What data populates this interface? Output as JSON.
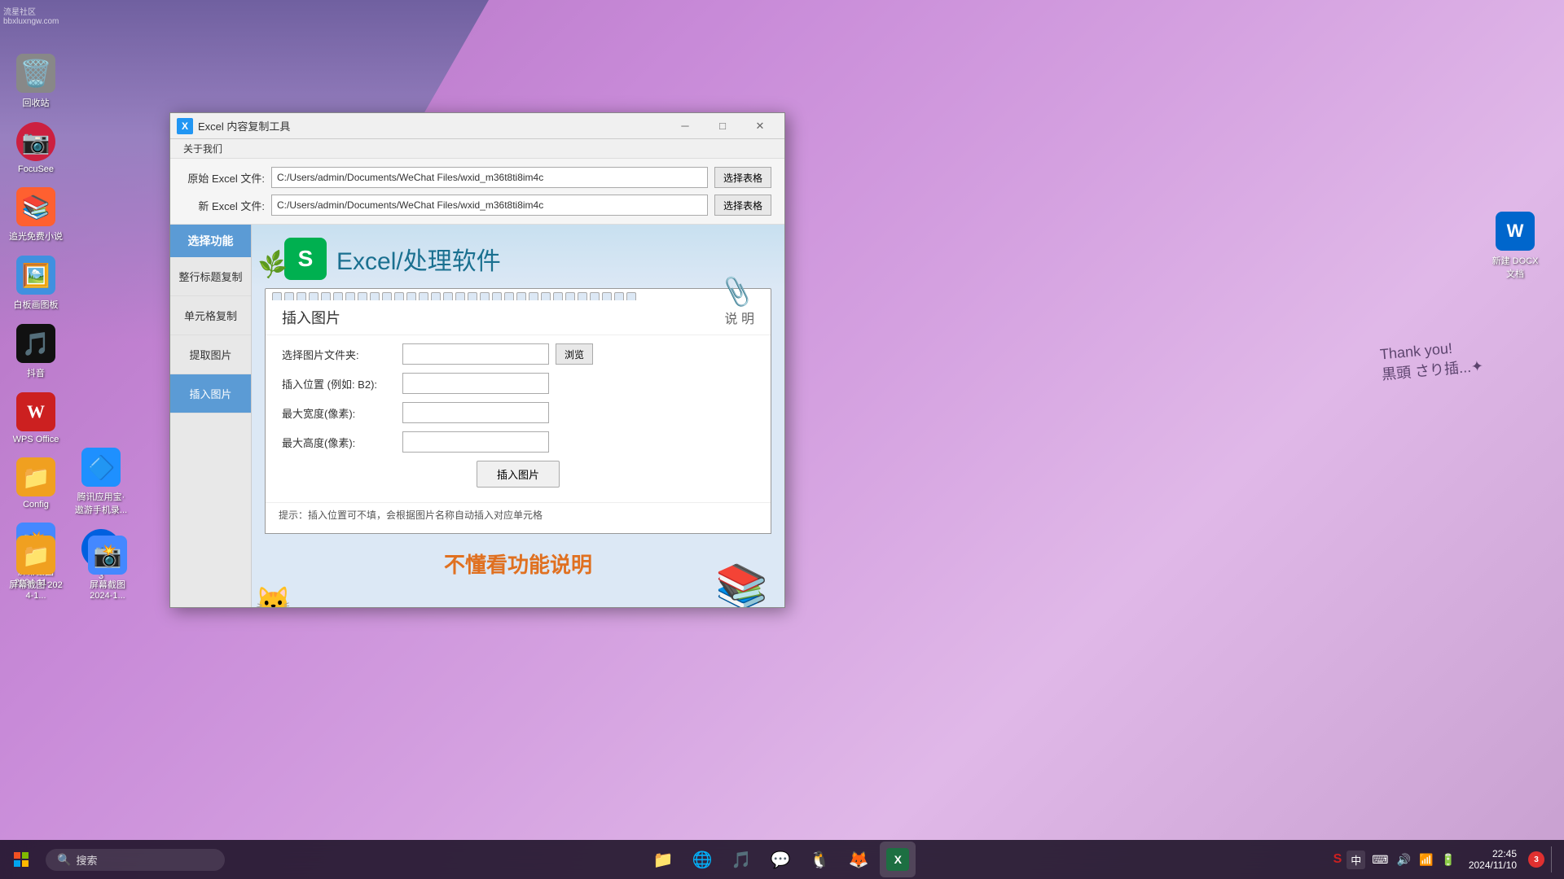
{
  "desktop": {
    "watermark": "流星社区\nbbxluxngw.com",
    "bg_color": "#c8a0d8"
  },
  "icons_left": [
    {
      "id": "recycle-bin",
      "label": "回收站",
      "emoji": "🗑️",
      "bg": "#e8e8e8"
    },
    {
      "id": "focussee",
      "label": "FocuSee",
      "emoji": "📷",
      "bg": "#e03050"
    },
    {
      "id": "novel-reader",
      "label": "追光免费小说",
      "emoji": "📖",
      "bg": "#ff6030"
    },
    {
      "id": "image-board",
      "label": "白板画图板",
      "emoji": "🖼️",
      "bg": "#4090e0"
    },
    {
      "id": "douyin",
      "label": "抖音",
      "emoji": "🎵",
      "bg": "#111111"
    },
    {
      "id": "wps-office",
      "label": "WPS Office",
      "emoji": "W",
      "bg": "#cc2020"
    },
    {
      "id": "config-folder",
      "label": "Config",
      "emoji": "📁",
      "bg": "#f0a020"
    },
    {
      "id": "screenshot1",
      "label": "屏幕截图\n2024-11-...",
      "emoji": "📸",
      "bg": "#4488ff"
    },
    {
      "id": "tencent-apps",
      "label": "腾讯应用宝·\n遨游手机录...",
      "emoji": "🔷",
      "bg": "#1e90ff"
    },
    {
      "id": "thunderbird",
      "label": "Thunderbird",
      "emoji": "🦅",
      "bg": "#0060df"
    },
    {
      "id": "folder3",
      "label": "3",
      "emoji": "📁",
      "bg": "#f0a020"
    },
    {
      "id": "screenshot2",
      "label": "屏幕截图\n2024-1...",
      "emoji": "📸",
      "bg": "#4488ff"
    }
  ],
  "icons_right": [
    {
      "id": "wps-docx",
      "label": "新建 DOCX\n文档",
      "emoji": "W",
      "bg": "#0066cc"
    }
  ],
  "window": {
    "title": "Excel 内容复制工具",
    "menu": {
      "about": "关于我们"
    },
    "original_file_label": "原始 Excel 文件:",
    "original_file_path": "C:/Users/admin/Documents/WeChat Files/wxid_m36t8ti8im4c",
    "new_file_label": "新 Excel 文件:",
    "new_file_path": "C:/Users/admin/Documents/WeChat Files/wxid_m36t8ti8im4c",
    "select_sheet_btn": "选择表格",
    "sidebar": {
      "header": "选择功能",
      "items": [
        {
          "id": "copy-row-header",
          "label": "整行标题复制",
          "active": false
        },
        {
          "id": "copy-cell",
          "label": "单元格复制",
          "active": false
        },
        {
          "id": "extract-image",
          "label": "提取图片",
          "active": false
        },
        {
          "id": "insert-image",
          "label": "插入图片",
          "active": true
        }
      ]
    },
    "banner_title": "Excel/处理软件",
    "banner_icon_letter": "S",
    "panel": {
      "title": "插入图片",
      "help": "说 明",
      "form": {
        "folder_label": "选择图片文件夹:",
        "folder_value": "",
        "folder_browse_btn": "浏览",
        "position_label": "插入位置 (例如: B2):",
        "position_value": "",
        "max_width_label": "最大宽度(像素):",
        "max_width_value": "",
        "max_height_label": "最大高度(像素):",
        "max_height_value": "",
        "execute_btn": "插入图片"
      },
      "tip": "提示：插入位置可不填，会根据图片名称自动插入对应单元格"
    },
    "bottom_text": "不懂看功能说明"
  },
  "taskbar": {
    "search_placeholder": "搜索",
    "clock": "22:45",
    "date": "2024/11/10",
    "notification_count": "3"
  }
}
